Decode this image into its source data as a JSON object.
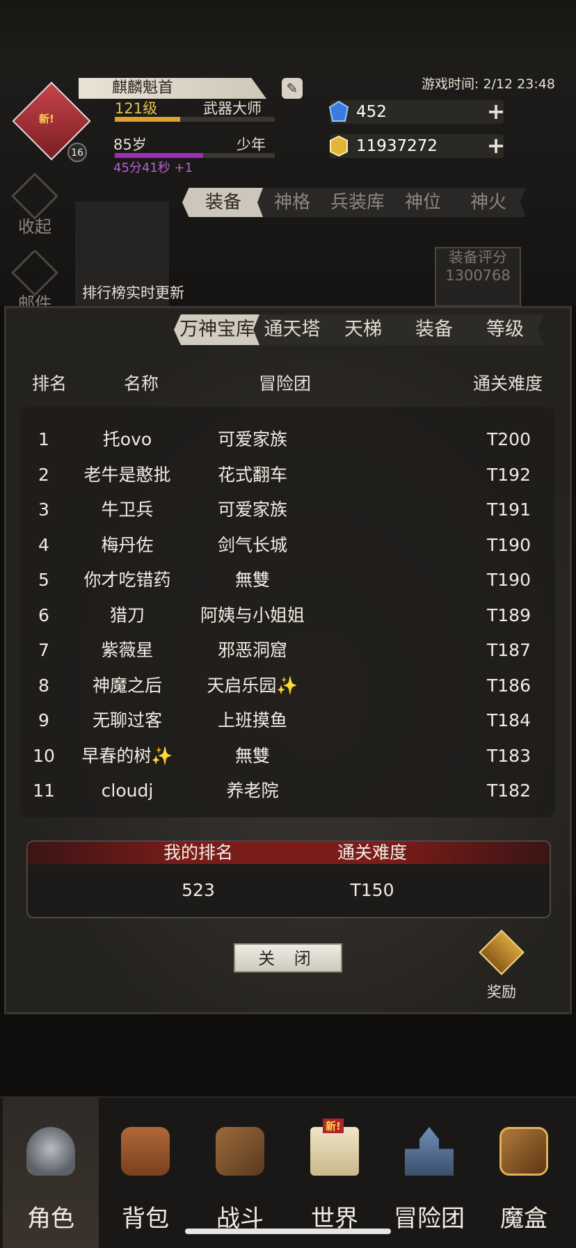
{
  "header": {
    "player_name": "麒麟魁首",
    "level_text": "121级",
    "class_text": "武器大师",
    "age_text": "85岁",
    "stage_text": "少年",
    "timer_text": "45分41秒 +1",
    "avatar_badge": "新!",
    "avatar_level": "16",
    "game_time": "游戏时间: 2/12 23:48",
    "gems": "452",
    "gold": "11937272",
    "xp_progress": 0.41,
    "age_progress": 0.55,
    "accent": "#c7434a",
    "xp_color": "#e0a22e",
    "age_color": "#9b2fb5"
  },
  "side": {
    "collapse_label": "收起",
    "mail_label": "邮件"
  },
  "top_tabs": [
    "装备",
    "神格",
    "兵装库",
    "神位",
    "神火"
  ],
  "rank_live_text": "排行榜实时更新",
  "equip_score": {
    "label": "装备评分",
    "value": "1300768"
  },
  "ranking": {
    "tabs": [
      "万神宝库",
      "通天塔",
      "天梯",
      "装备",
      "等级"
    ],
    "columns": [
      "排名",
      "名称",
      "冒险团",
      "通关难度"
    ],
    "rows": [
      {
        "rank": "1",
        "name": "托ovo",
        "guild": "可爱家族",
        "difficulty": "T200"
      },
      {
        "rank": "2",
        "name": "老牛是憨批",
        "guild": "花式翻车",
        "difficulty": "T192"
      },
      {
        "rank": "3",
        "name": "牛卫兵",
        "guild": "可爱家族",
        "difficulty": "T191"
      },
      {
        "rank": "4",
        "name": "梅丹佐",
        "guild": "剑气长城",
        "difficulty": "T190"
      },
      {
        "rank": "5",
        "name": "你才吃错药",
        "guild": "無雙",
        "difficulty": "T190"
      },
      {
        "rank": "6",
        "name": "猎刀",
        "guild": "阿姨与小姐姐",
        "difficulty": "T189"
      },
      {
        "rank": "7",
        "name": "紫薇星",
        "guild": "邪恶洞窟",
        "difficulty": "T187"
      },
      {
        "rank": "8",
        "name": "神魔之后",
        "guild": "天启乐园✨",
        "difficulty": "T186"
      },
      {
        "rank": "9",
        "name": "无聊过客",
        "guild": "上班摸鱼",
        "difficulty": "T184"
      },
      {
        "rank": "10",
        "name": "早春的树✨",
        "guild": "無雙",
        "difficulty": "T183"
      },
      {
        "rank": "11",
        "name": "cloudj",
        "guild": "养老院",
        "difficulty": "T182"
      }
    ],
    "my_rank_label": "我的排名",
    "my_difficulty_label": "通关难度",
    "my_rank": "523",
    "my_difficulty": "T150",
    "close_label": "关 闭",
    "reward_label": "奖励"
  },
  "nav": [
    {
      "label": "角色",
      "icon": "helmet-icon"
    },
    {
      "label": "背包",
      "icon": "backpack-icon"
    },
    {
      "label": "战斗",
      "icon": "sword-shield-icon"
    },
    {
      "label": "世界",
      "icon": "scroll-map-icon"
    },
    {
      "label": "冒险团",
      "icon": "castle-icon"
    },
    {
      "label": "魔盒",
      "icon": "magic-box-icon"
    }
  ],
  "nav_badge": "新!"
}
